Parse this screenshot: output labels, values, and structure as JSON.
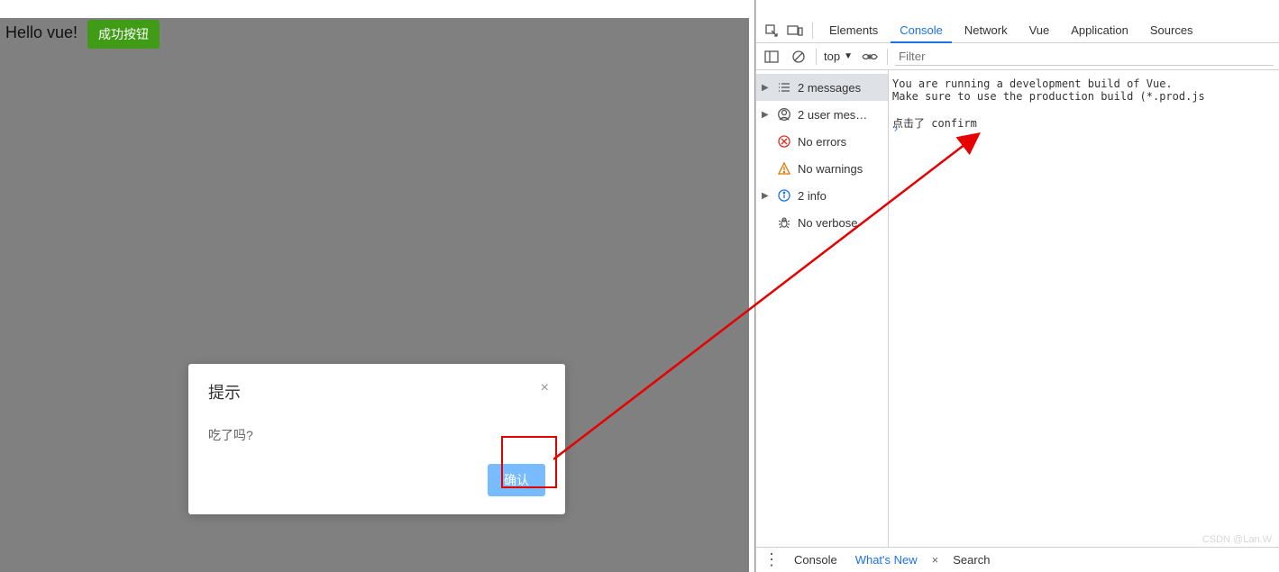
{
  "app": {
    "hello": "Hello vue!",
    "success_button": "成功按钮",
    "dialog": {
      "title": "提示",
      "body": "吃了吗?",
      "confirm": "确认"
    }
  },
  "devtools": {
    "tabs": {
      "elements": "Elements",
      "console": "Console",
      "network": "Network",
      "vue": "Vue",
      "application": "Application",
      "sources": "Sources"
    },
    "context": "top",
    "filter_placeholder": "Filter",
    "sidebar": {
      "messages": "2 messages",
      "user": "2 user mes…",
      "errors": "No errors",
      "warnings": "No warnings",
      "info": "2 info",
      "verbose": "No verbose"
    },
    "log": {
      "vue_dev": "You are running a development build of Vue.\nMake sure to use the production build (*.prod.js",
      "click": "点击了 confirm"
    },
    "bottom": {
      "console": "Console",
      "whatsnew": "What's New",
      "search": "Search"
    },
    "watermark": "CSDN @Lan.W"
  }
}
